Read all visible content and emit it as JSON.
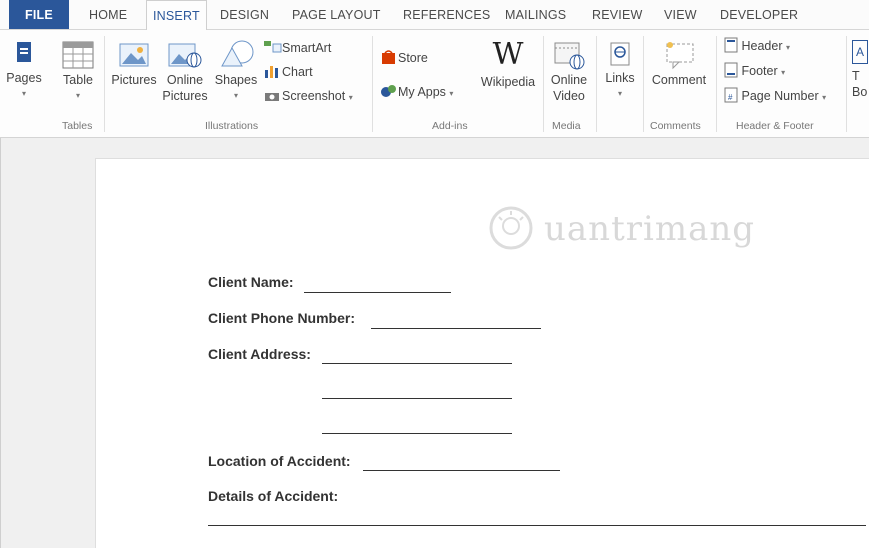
{
  "tabs": {
    "file": "FILE",
    "home": "HOME",
    "insert": "INSERT",
    "design": "DESIGN",
    "page_layout": "PAGE LAYOUT",
    "references": "REFERENCES",
    "mailings": "MAILINGS",
    "review": "REVIEW",
    "view": "VIEW",
    "developer": "DEVELOPER"
  },
  "ribbon": {
    "pages": "Pages",
    "table": "Table",
    "pictures": "Pictures",
    "online_pictures_1": "Online",
    "online_pictures_2": "Pictures",
    "shapes": "Shapes",
    "smartart": "SmartArt",
    "chart": "Chart",
    "screenshot": "Screenshot",
    "store": "Store",
    "my_apps": "My Apps",
    "wikipedia": "Wikipedia",
    "online_video_1": "Online",
    "online_video_2": "Video",
    "links": "Links",
    "comment": "Comment",
    "header": "Header",
    "footer": "Footer",
    "page_number": "Page Number",
    "textbox_partial_1": "T",
    "textbox_partial_2": "Bo",
    "groups": {
      "tables": "Tables",
      "illustrations": "Illustrations",
      "addins": "Add-ins",
      "media": "Media",
      "comments": "Comments",
      "header_footer": "Header & Footer"
    }
  },
  "document": {
    "client_name": "Client Name:",
    "client_phone": "Client Phone Number:",
    "client_address": "Client Address:",
    "location": "Location of Accident:",
    "details": "Details of Accident:",
    "watermark": "uantrimang"
  },
  "colors": {
    "file_tab": "#2b579a",
    "active_tab_text": "#2b579a",
    "store_icon": "#d83b01",
    "chart_icon": "#2b579a"
  }
}
